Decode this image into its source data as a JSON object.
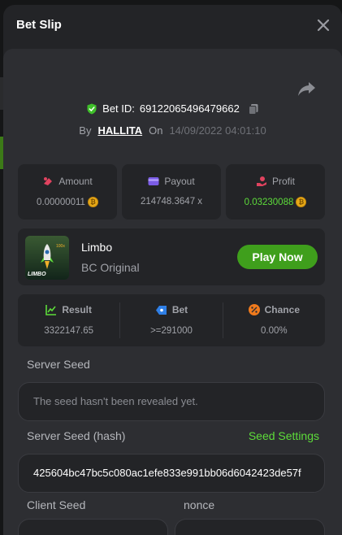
{
  "modal": {
    "title": "Bet Slip"
  },
  "bet": {
    "id_label": "Bet ID:",
    "id_value": "69122065496479662",
    "by_label": "By",
    "user": "HALLITA",
    "on_label": "On",
    "datetime": "14/09/2022 04:01:10"
  },
  "stats": {
    "amount": {
      "label": "Amount",
      "value": "0.00000011"
    },
    "payout": {
      "label": "Payout",
      "value": "214748.3647 x"
    },
    "profit": {
      "label": "Profit",
      "value": "0.03230088"
    }
  },
  "game": {
    "name": "Limbo",
    "provider": "BC Original",
    "thumb_text": "LIMBO",
    "play_label": "Play Now"
  },
  "result": {
    "result": {
      "label": "Result",
      "value": "3322147.65"
    },
    "bet": {
      "label": "Bet",
      "value": ">=291000"
    },
    "chance": {
      "label": "Chance",
      "value": "0.00%"
    }
  },
  "seeds": {
    "server_seed_label": "Server Seed",
    "server_seed_value": "The seed hasn't been revealed yet.",
    "server_hash_label": "Server Seed (hash)",
    "seed_settings_label": "Seed Settings",
    "server_hash_value": "425604bc47bc5c080ac1efe833e991bb06d6042423de57f",
    "client_seed_label": "Client Seed",
    "nonce_label": "nonce"
  },
  "colors": {
    "accent_green": "#5ddc3a",
    "play_button": "#3f9f1c",
    "coin": "#e6a817"
  }
}
